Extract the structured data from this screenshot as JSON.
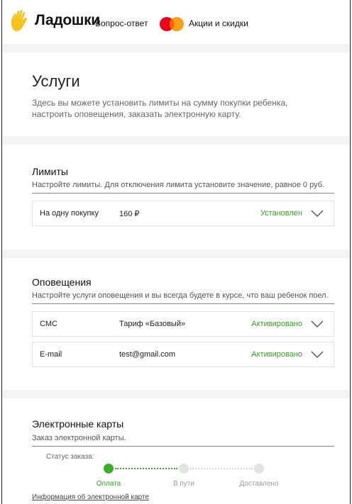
{
  "header": {
    "brand": "Ладошки",
    "nav_faq": "Вопрос-ответ",
    "nav_promo": "Акции и скидки"
  },
  "services": {
    "title": "Услуги",
    "description": "Здесь вы можете установить лимиты на сумму покупки ребенка, настроить оповещения, заказать электронную карту."
  },
  "limits": {
    "title": "Лимиты",
    "subtitle": "Настройте лимиты. Для отключения лимита установите значение, равное 0 руб.",
    "items": [
      {
        "name": "На одну покупку",
        "value": "160 ₽",
        "status": "Установлен"
      }
    ]
  },
  "notifications": {
    "title": "Оповещения",
    "subtitle": "Настройте услуги оповещения и вы всегда будете в курсе, что ваш ребенок поел.",
    "items": [
      {
        "name": "СМС",
        "value": "Тариф «Базовый»",
        "status": "Активировано"
      },
      {
        "name": "E-mail",
        "value": "test@gmail.com",
        "status": "Активировано"
      }
    ]
  },
  "ecards": {
    "title": "Электронные карты",
    "subtitle": "Заказ электронной карты.",
    "order_status_label": "Статус заказа:",
    "steps": [
      {
        "label": "Оплата",
        "done": true
      },
      {
        "label": "В пути",
        "done": false
      },
      {
        "label": "Доставлено",
        "done": false
      }
    ],
    "info_link": "Информация об электронной карте"
  },
  "colors": {
    "accent_green": "#3a9b2b",
    "brand_yellow": "#f7c21b",
    "mc_red": "#eb001b",
    "mc_orange": "#f79e1b"
  }
}
